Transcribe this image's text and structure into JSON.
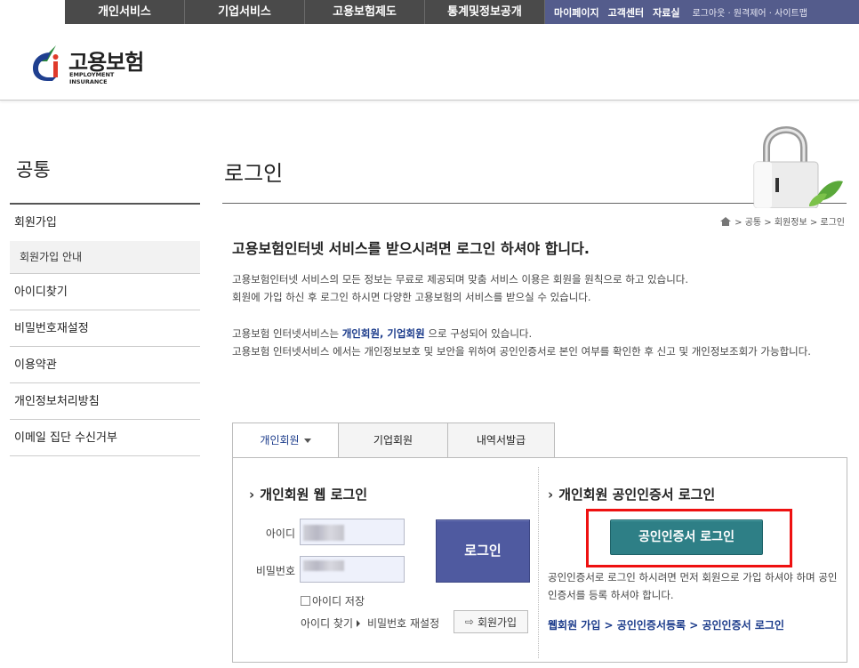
{
  "topnav": {
    "menu": [
      "개인서비스",
      "기업서비스",
      "고용보험제도",
      "통계및정보공개"
    ],
    "util": [
      "마이페이지",
      "고객센터",
      "자료실"
    ],
    "util_small": "로그아웃 · 원격제어 · 사이트맵"
  },
  "logo": {
    "name": "고용보험",
    "sub": "EMPLOYMENT INSURANCE"
  },
  "sidebar": {
    "title": "공통",
    "items": [
      {
        "label": "회원가입"
      },
      {
        "label": "아이디찾기"
      },
      {
        "label": "비밀번호재설정"
      },
      {
        "label": "이용약관"
      },
      {
        "label": "개인정보처리방침"
      },
      {
        "label": "이메일 집단 수신거부"
      }
    ],
    "subitem": "회원가입 안내"
  },
  "page": {
    "title": "로그인",
    "breadcrumb": "> 공통 > 회원정보 > 로그인",
    "lead": "고용보험인터넷 서비스를 받으시려면 로그인 하셔야 합니다.",
    "para1_line1": "고용보험인터넷 서비스의 모든 정보는 무료로 제공되며 맞춤 서비스 이용은 회원을 원칙으로 하고 있습니다.",
    "para1_line2": "회원에 가입 하신 후 로그인 하시면 다양한 고용보험의 서비스를 받으실 수 있습니다.",
    "para2_prefix": "고용보험 인터넷서비스는 ",
    "para2_bold": "개인회원, 기업회원",
    "para2_suffix": " 으로 구성되어 있습니다.",
    "para3": "고용보험 인터넷서비스 에서는 개인정보보호 및 보안을 위하여 공인인증서로 본인 여부를 확인한 후 신고 및 개인정보조회가 가능합니다."
  },
  "tabs": [
    "개인회원",
    "기업회원",
    "내역서발급"
  ],
  "web_login": {
    "title": "개인회원 웹 로그인",
    "id_label": "아이디",
    "pw_label": "비밀번호",
    "login_button": "로그인",
    "save_id": "아이디 저장",
    "find_id": "아이디 찾기",
    "reset_pw": "비밀번호 재설정",
    "join_button": "회원가입"
  },
  "cert_login": {
    "title": "개인회원 공인인증서 로그인",
    "button": "공인인증서 로그인",
    "desc": "공인인증서로 로그인 하시려면 먼저 회원으로 가입 하셔야 하며 공인인증서를 등록 하셔야 합니다.",
    "links": "웹회원 가입 > 공인인증서등록 > 공인인증서 로그인"
  },
  "colors": {
    "nav_bg": "#4a4a4a",
    "util_bg": "#545c8c",
    "login_btn": "#4f5aa0",
    "cert_btn": "#2e7f86",
    "highlight": "#e11111"
  }
}
